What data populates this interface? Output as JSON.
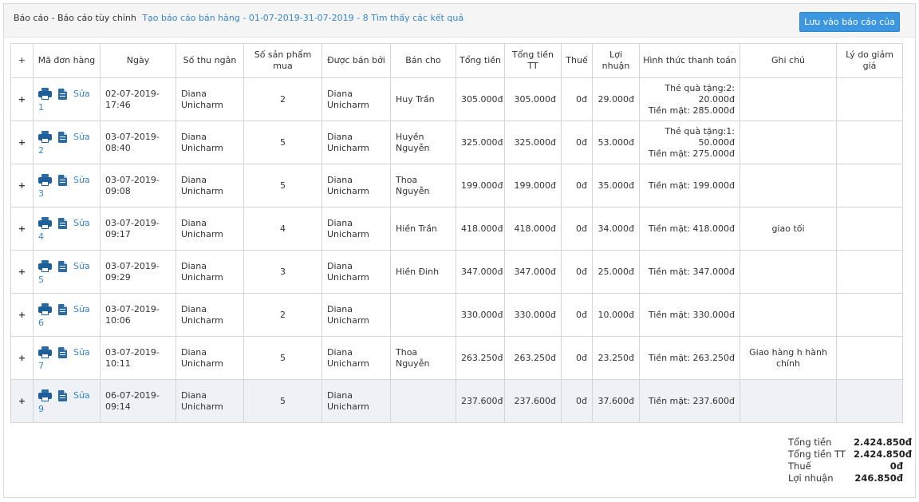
{
  "header": {
    "title": "Báo cáo - Báo cáo tùy chỉnh",
    "subtitle": "Tạo báo cáo bán hàng - 01-07-2019-31-07-2019 - 8 Tìm thấy các kết quả",
    "save_button": "Lưu vào báo cáo của tôi"
  },
  "table": {
    "columns": [
      "+",
      "Mã đơn hàng",
      "Ngày",
      "Số thu ngân",
      "Số sản phẩm mua",
      "Được bán bởi",
      "Bán cho",
      "Tổng tiền",
      "Tổng tiền TT",
      "Thuế",
      "Lợi nhuận",
      "Hình thức thanh toán",
      "Ghi chú",
      "Lý do giảm giá"
    ],
    "edit_label": "Sửa",
    "rows": [
      {
        "id": "1",
        "date": "02-07-2019-\n17:46",
        "cashier": "Diana\nUnicharm",
        "qty": "2",
        "sold_by": "Diana\nUnicharm",
        "sold_to": "Huy Trần",
        "total": "305.000đ",
        "total_tt": "305.000đ",
        "tax": "0đ",
        "profit": "29.000đ",
        "payment": "Thẻ quà tặng:2:\n20.000đ\nTiền mặt: 285.000đ",
        "note": "",
        "discount_reason": ""
      },
      {
        "id": "2",
        "date": "03-07-2019-\n08:40",
        "cashier": "Diana\nUnicharm",
        "qty": "5",
        "sold_by": "Diana\nUnicharm",
        "sold_to": "Huyền\nNguyễn",
        "total": "325.000đ",
        "total_tt": "325.000đ",
        "tax": "0đ",
        "profit": "53.000đ",
        "payment": "Thẻ quà tặng:1:\n50.000đ\nTiền mặt: 275.000đ",
        "note": "",
        "discount_reason": ""
      },
      {
        "id": "3",
        "date": "03-07-2019-\n09:08",
        "cashier": "Diana\nUnicharm",
        "qty": "5",
        "sold_by": "Diana\nUnicharm",
        "sold_to": "Thoa Nguyễn",
        "total": "199.000đ",
        "total_tt": "199.000đ",
        "tax": "0đ",
        "profit": "35.000đ",
        "payment": "Tiền mặt: 199.000đ",
        "note": "",
        "discount_reason": ""
      },
      {
        "id": "4",
        "date": "03-07-2019-\n09:17",
        "cashier": "Diana\nUnicharm",
        "qty": "4",
        "sold_by": "Diana\nUnicharm",
        "sold_to": "Hiền Trần",
        "total": "418.000đ",
        "total_tt": "418.000đ",
        "tax": "0đ",
        "profit": "34.000đ",
        "payment": "Tiền mặt: 418.000đ",
        "note": "giao tối",
        "discount_reason": ""
      },
      {
        "id": "5",
        "date": "03-07-2019-\n09:29",
        "cashier": "Diana\nUnicharm",
        "qty": "3",
        "sold_by": "Diana\nUnicharm",
        "sold_to": "Hiền Đinh",
        "total": "347.000đ",
        "total_tt": "347.000đ",
        "tax": "0đ",
        "profit": "25.000đ",
        "payment": "Tiền mặt: 347.000đ",
        "note": "",
        "discount_reason": ""
      },
      {
        "id": "6",
        "date": "03-07-2019-\n10:06",
        "cashier": "Diana\nUnicharm",
        "qty": "2",
        "sold_by": "Diana\nUnicharm",
        "sold_to": "",
        "total": "330.000đ",
        "total_tt": "330.000đ",
        "tax": "0đ",
        "profit": "10.000đ",
        "payment": "Tiền mặt: 330.000đ",
        "note": "",
        "discount_reason": ""
      },
      {
        "id": "7",
        "date": "03-07-2019-\n10:11",
        "cashier": "Diana\nUnicharm",
        "qty": "5",
        "sold_by": "Diana\nUnicharm",
        "sold_to": "Thoa Nguyễn",
        "total": "263.250đ",
        "total_tt": "263.250đ",
        "tax": "0đ",
        "profit": "23.250đ",
        "payment": "Tiền mặt: 263.250đ",
        "note": "Giao hàng h hành\nchính",
        "discount_reason": ""
      },
      {
        "id": "9",
        "date": "06-07-2019-\n09:14",
        "cashier": "Diana\nUnicharm",
        "qty": "5",
        "sold_by": "Diana\nUnicharm",
        "sold_to": "",
        "total": "237.600đ",
        "total_tt": "237.600đ",
        "tax": "0đ",
        "profit": "37.600đ",
        "payment": "Tiền mặt: 237.600đ",
        "note": "",
        "discount_reason": "",
        "highlighted": true
      }
    ]
  },
  "summary": [
    {
      "label": "Tổng tiền",
      "value": "2.424.850đ"
    },
    {
      "label": "Tổng tiền TT",
      "value": "2.424.850đ"
    },
    {
      "label": "Thuế",
      "value": "0đ"
    },
    {
      "label": "Lợi nhuận",
      "value": "246.850đ"
    }
  ]
}
